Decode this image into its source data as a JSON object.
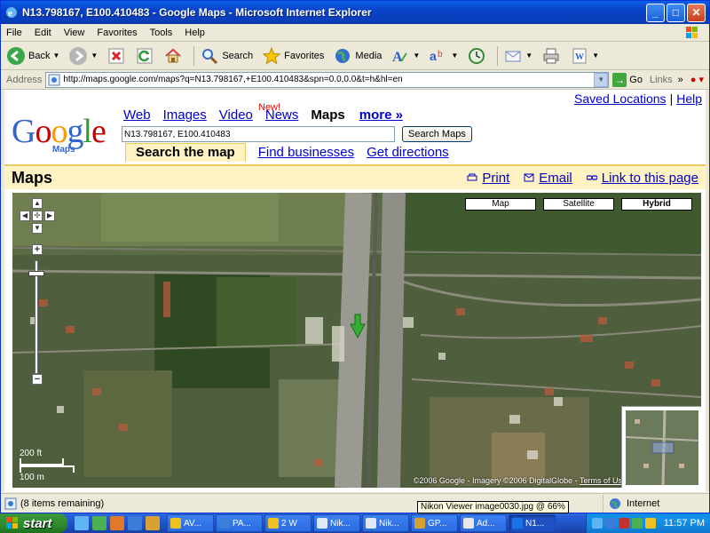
{
  "window": {
    "title": "N13.798167, E100.410483 - Google Maps - Microsoft Internet Explorer",
    "minimize": "_",
    "maximize": "□",
    "close": "✕"
  },
  "menu": [
    "File",
    "Edit",
    "View",
    "Favorites",
    "Tools",
    "Help"
  ],
  "toolbar": {
    "back_label": "Back",
    "search_label": "Search",
    "favorites_label": "Favorites",
    "media_label": "Media"
  },
  "address": {
    "label": "Address",
    "url": "http://maps.google.com/maps?q=N13.798167,+E100.410483&spn=0.0,0.0&t=h&hl=en",
    "go_label": "Go",
    "links_label": "Links"
  },
  "page": {
    "top_links": {
      "saved_locations": "Saved Locations",
      "separator": "|",
      "help": "Help"
    },
    "logo": {
      "letters": [
        "G",
        "o",
        "o",
        "g",
        "l",
        "e"
      ],
      "colors": [
        "#3366cc",
        "#cc0000",
        "#ff9900",
        "#3366cc",
        "#339933",
        "#cc0000"
      ],
      "sub": "Maps"
    },
    "nav": {
      "web": "Web",
      "images": "Images",
      "video": "Video",
      "new_badge": "New!",
      "news": "News",
      "maps": "Maps",
      "more": "more »"
    },
    "search": {
      "value": "N13.798167, E100.410483",
      "button": "Search Maps"
    },
    "subtabs": {
      "search_map": "Search the map",
      "find_businesses": "Find businesses",
      "get_directions": "Get directions"
    },
    "maps_bar": {
      "heading": "Maps",
      "print": "Print",
      "email": "Email",
      "link": "Link to this page"
    },
    "map": {
      "type_buttons": [
        "Map",
        "Satellite",
        "Hybrid"
      ],
      "active_type": "Hybrid",
      "zoom_in": "+",
      "zoom_out": "−",
      "zoom_level_fraction": 0.1,
      "scale_ft": "200 ft",
      "scale_m": "100 m",
      "copyright_text": "©2006 Google - Imagery ©2006 DigitalGlobe - ",
      "terms": "Terms of Use"
    }
  },
  "statusbar": {
    "text": "(8 items remaining)",
    "zone": "Internet"
  },
  "tooltip": "Nikon Viewer image0030.jpg @ 66%",
  "taskbar": {
    "start": "start",
    "tasks": [
      {
        "label": "AV...",
        "color": "#f0c020"
      },
      {
        "label": "PA...",
        "color": "#3b7fd8"
      },
      {
        "label": "2 W",
        "color": "#f0c020"
      },
      {
        "label": "Nik...",
        "color": "#dfe8f8"
      },
      {
        "label": "Nik...",
        "color": "#dfe8f8"
      },
      {
        "label": "GP...",
        "color": "#d8a030"
      },
      {
        "label": "Ad...",
        "color": "#e8e8e8"
      },
      {
        "label": "N1...",
        "color": "#1a73e8"
      }
    ],
    "clock": "11:57 PM"
  }
}
